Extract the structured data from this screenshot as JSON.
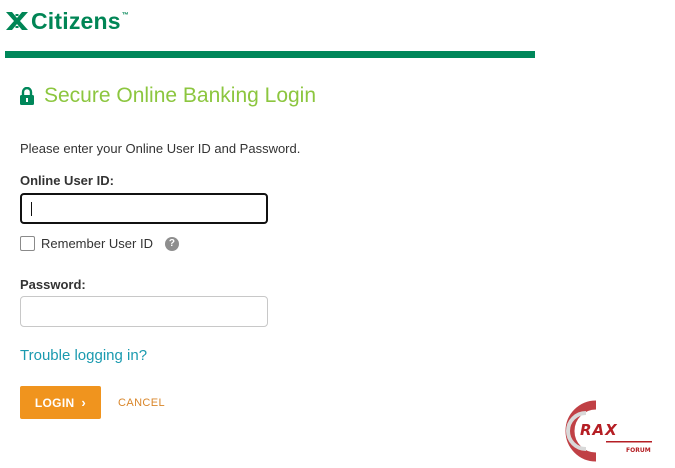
{
  "brand": {
    "name": "Citizens",
    "trademark": "™",
    "logo_icon": "citizens-snowflake-icon",
    "accent_color": "#008555"
  },
  "page": {
    "heading": "Secure Online Banking Login",
    "heading_icon": "lock-icon",
    "heading_color": "#8cc63f",
    "instructions": "Please enter your Online User ID and Password."
  },
  "form": {
    "userid_label": "Online User ID:",
    "userid_value": "",
    "remember_label": "Remember User ID",
    "remember_checked": false,
    "help_glyph": "?",
    "password_label": "Password:",
    "password_value": ""
  },
  "links": {
    "trouble": "Trouble logging in?"
  },
  "actions": {
    "login_label": "LOGIN",
    "login_chevron": "›",
    "login_color": "#f0941e",
    "cancel_label": "CANCEL"
  },
  "watermark": {
    "text": "RAX",
    "sub": "FORUM"
  }
}
